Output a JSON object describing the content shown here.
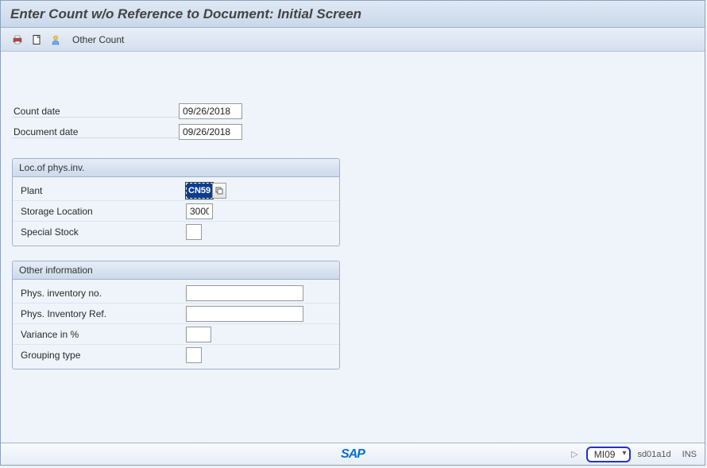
{
  "title": "Enter Count w/o Reference to Document: Initial Screen",
  "toolbar": {
    "other_count": "Other Count"
  },
  "dates": {
    "count_date_label": "Count date",
    "count_date": "09/26/2018",
    "document_date_label": "Document date",
    "document_date": "09/26/2018"
  },
  "loc_group": {
    "header": "Loc.of phys.inv.",
    "plant_label": "Plant",
    "plant": "CN59",
    "sloc_label": "Storage Location",
    "sloc": "3000",
    "spec_label": "Special Stock",
    "spec": ""
  },
  "other_group": {
    "header": "Other information",
    "phys_no_label": "Phys. inventory no.",
    "phys_no": "",
    "phys_ref_label": "Phys. Inventory Ref.",
    "phys_ref": "",
    "variance_label": "Variance in %",
    "variance": "",
    "grouping_label": "Grouping type",
    "grouping": ""
  },
  "status": {
    "logo": "SAP",
    "tcode": "MI09",
    "system": "sd01a1d",
    "mode": "INS"
  }
}
